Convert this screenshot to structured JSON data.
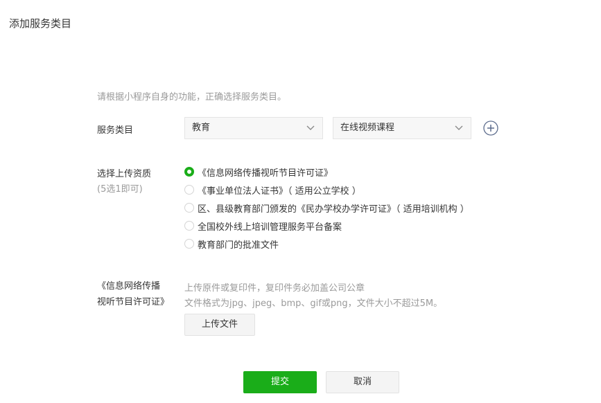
{
  "page": {
    "title": "添加服务类目",
    "hint": "请根据小程序自身的功能，正确选择服务类目。"
  },
  "category": {
    "label": "服务类目",
    "primary_value": "教育",
    "secondary_value": "在线视频课程",
    "add_icon": "plus-circle-icon",
    "chevron_icon": "chevron-down-icon"
  },
  "qualification": {
    "label": "选择上传资质",
    "sub_label": "(5选1即可)",
    "options": [
      {
        "text": "《信息网络传播视听节目许可证》",
        "checked": true
      },
      {
        "text": "《事业单位法人证书》（ 适用公立学校 ）",
        "checked": false
      },
      {
        "text": "区、县级教育部门颁发的《民办学校办学许可证》（ 适用培训机构 ）",
        "checked": false
      },
      {
        "text": "全国校外线上培训管理服务平台备案",
        "checked": false
      },
      {
        "text": "教育部门的批准文件",
        "checked": false
      }
    ]
  },
  "upload": {
    "doc_name": "《信息网络传播视听节目许可证》",
    "hint_1": "上传原件或复印件，复印件务必加盖公司公章",
    "hint_2": "文件格式为jpg、jpeg、bmp、gif或png，文件大小不超过5M。",
    "button_label": "上传文件"
  },
  "actions": {
    "submit_label": "提交",
    "cancel_label": "取消"
  },
  "colors": {
    "accent": "#1aad19",
    "hint_text": "#9a9a9a",
    "body_text": "#353535",
    "icon_blue": "#5b6b8c"
  }
}
